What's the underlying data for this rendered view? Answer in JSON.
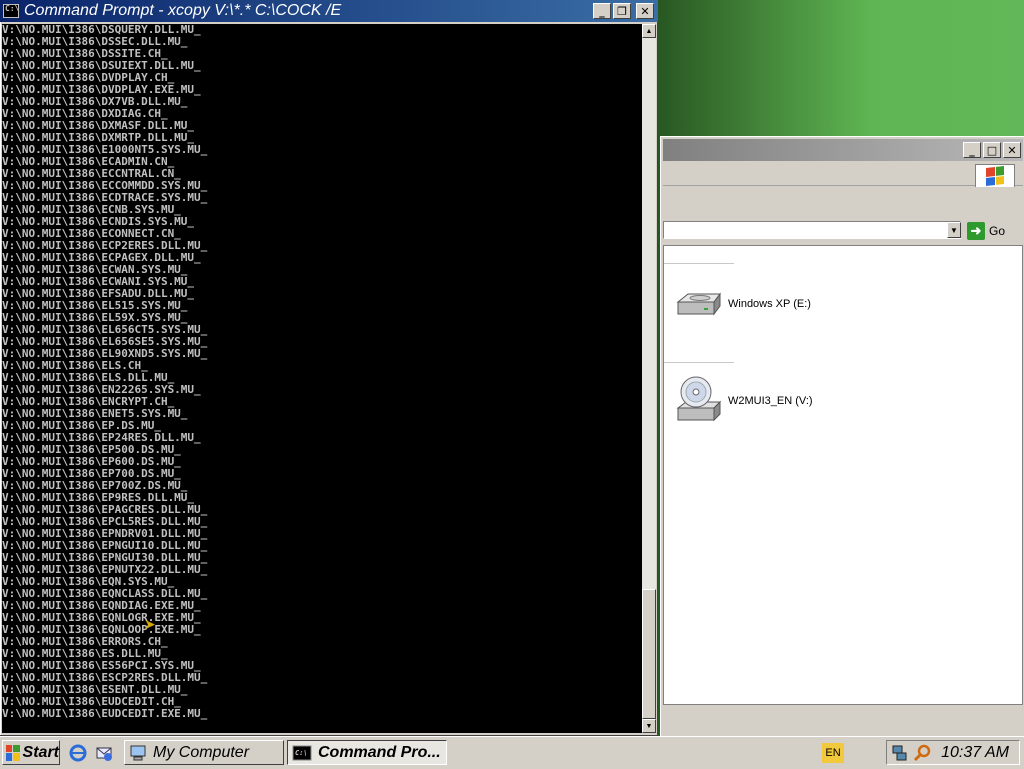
{
  "cmd": {
    "title": "Command Prompt - xcopy V:\\*.* C:\\COCK /E",
    "lines": [
      "V:\\NO.MUI\\I386\\DSQUERY.DLL.MU_",
      "V:\\NO.MUI\\I386\\DSSEC.DLL.MU_",
      "V:\\NO.MUI\\I386\\DSSITE.CH_",
      "V:\\NO.MUI\\I386\\DSUIEXT.DLL.MU_",
      "V:\\NO.MUI\\I386\\DVDPLAY.CH_",
      "V:\\NO.MUI\\I386\\DVDPLAY.EXE.MU_",
      "V:\\NO.MUI\\I386\\DX7VB.DLL.MU_",
      "V:\\NO.MUI\\I386\\DXDIAG.CH_",
      "V:\\NO.MUI\\I386\\DXMASF.DLL.MU_",
      "V:\\NO.MUI\\I386\\DXMRTP.DLL.MU_",
      "V:\\NO.MUI\\I386\\E1000NT5.SYS.MU_",
      "V:\\NO.MUI\\I386\\ECADMIN.CN_",
      "V:\\NO.MUI\\I386\\ECCNTRAL.CN_",
      "V:\\NO.MUI\\I386\\ECCOMMDD.SYS.MU_",
      "V:\\NO.MUI\\I386\\ECDTRACE.SYS.MU_",
      "V:\\NO.MUI\\I386\\ECNB.SYS.MU_",
      "V:\\NO.MUI\\I386\\ECNDIS.SYS.MU_",
      "V:\\NO.MUI\\I386\\ECONNECT.CN_",
      "V:\\NO.MUI\\I386\\ECP2ERES.DLL.MU_",
      "V:\\NO.MUI\\I386\\ECPAGEX.DLL.MU_",
      "V:\\NO.MUI\\I386\\ECWAN.SYS.MU_",
      "V:\\NO.MUI\\I386\\ECWANI.SYS.MU_",
      "V:\\NO.MUI\\I386\\EFSADU.DLL.MU_",
      "V:\\NO.MUI\\I386\\EL515.SYS.MU_",
      "V:\\NO.MUI\\I386\\EL59X.SYS.MU_",
      "V:\\NO.MUI\\I386\\EL656CT5.SYS.MU_",
      "V:\\NO.MUI\\I386\\EL656SE5.SYS.MU_",
      "V:\\NO.MUI\\I386\\EL90XND5.SYS.MU_",
      "V:\\NO.MUI\\I386\\ELS.CH_",
      "V:\\NO.MUI\\I386\\ELS.DLL.MU_",
      "V:\\NO.MUI\\I386\\EN22265.SYS.MU_",
      "V:\\NO.MUI\\I386\\ENCRYPT.CH_",
      "V:\\NO.MUI\\I386\\ENET5.SYS.MU_",
      "V:\\NO.MUI\\I386\\EP.DS.MU_",
      "V:\\NO.MUI\\I386\\EP24RES.DLL.MU_",
      "V:\\NO.MUI\\I386\\EP500.DS.MU_",
      "V:\\NO.MUI\\I386\\EP600.DS.MU_",
      "V:\\NO.MUI\\I386\\EP700.DS.MU_",
      "V:\\NO.MUI\\I386\\EP700Z.DS.MU_",
      "V:\\NO.MUI\\I386\\EP9RES.DLL.MU_",
      "V:\\NO.MUI\\I386\\EPAGCRES.DLL.MU_",
      "V:\\NO.MUI\\I386\\EPCL5RES.DLL.MU_",
      "V:\\NO.MUI\\I386\\EPNDRV01.DLL.MU_",
      "V:\\NO.MUI\\I386\\EPNGUI10.DLL.MU_",
      "V:\\NO.MUI\\I386\\EPNGUI30.DLL.MU_",
      "V:\\NO.MUI\\I386\\EPNUTX22.DLL.MU_",
      "V:\\NO.MUI\\I386\\EQN.SYS.MU_",
      "V:\\NO.MUI\\I386\\EQNCLASS.DLL.MU_",
      "V:\\NO.MUI\\I386\\EQNDIAG.EXE.MU_",
      "V:\\NO.MUI\\I386\\EQNLOGR.EXE.MU_",
      "V:\\NO.MUI\\I386\\EQNLOOP.EXE.MU_",
      "V:\\NO.MUI\\I386\\ERRORS.CH_",
      "V:\\NO.MUI\\I386\\ES.DLL.MU_",
      "V:\\NO.MUI\\I386\\ES56PCI.SYS.MU_",
      "V:\\NO.MUI\\I386\\ESCP2RES.DLL.MU_",
      "V:\\NO.MUI\\I386\\ESENT.DLL.MU_",
      "V:\\NO.MUI\\I386\\EUDCEDIT.CH_",
      "V:\\NO.MUI\\I386\\EUDCEDIT.EXE.MU_"
    ]
  },
  "explorer": {
    "go_label": "Go",
    "drives": [
      {
        "label": "Windows XP (E:)",
        "icon": "hard-drive-icon"
      },
      {
        "label": "W2MUI3_EN (V:)",
        "icon": "cd-drive-icon"
      }
    ]
  },
  "taskbar": {
    "start_label": "Start",
    "tasks": [
      {
        "label": "My Computer",
        "active": false
      },
      {
        "label": "Command Pro...",
        "active": true
      }
    ],
    "language": "EN",
    "clock": "10:37 AM"
  },
  "colors": {
    "title_active": "#0a246a",
    "title_inactive": "#808080",
    "console_bg": "#000000",
    "console_fg": "#c0c0c0",
    "face": "#d4d0c8"
  }
}
